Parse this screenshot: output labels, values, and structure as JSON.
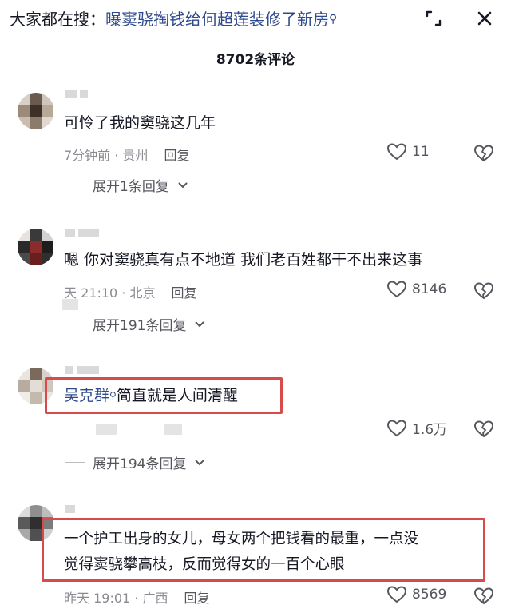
{
  "header": {
    "search_prefix": "大家都在搜：",
    "search_query": "曝窦骁掏钱给何超莲装修了新房",
    "search_mag": "⚲",
    "expand_icon": "expand-icon",
    "close_icon": "close-icon"
  },
  "comments_count": "8702条评论",
  "comments": [
    {
      "text": "可怜了我的窦骁这几年",
      "meta": "7分钟前 · 贵州",
      "reply_label": "回复",
      "likes": "11",
      "expand_label": "展开1条回复"
    },
    {
      "text": "嗯 你对窦骁真有点不地道 我们老百姓都干不出来这事",
      "meta": "天 21:10 · 北京",
      "reply_label": "回复",
      "likes": "8146",
      "expand_label": "展开191条回复"
    },
    {
      "text_link": "吴克群",
      "text_mag": "⚲",
      "text": "简直就是人间清醒",
      "likes": "1.6万",
      "expand_label": "展开194条回复"
    },
    {
      "text_line1": "一个护工出身的女儿，母女两个把钱看的最重，一点没",
      "text_line2": "觉得窦骁攀高枝，反而觉得女的一百个心眼",
      "meta": "昨天 19:01 · 广西",
      "reply_label": "回复",
      "likes": "8569"
    }
  ],
  "colors": {
    "highlight_box": "#d94a4a",
    "link": "#2f4a8c",
    "meta": "#8a8b91"
  }
}
